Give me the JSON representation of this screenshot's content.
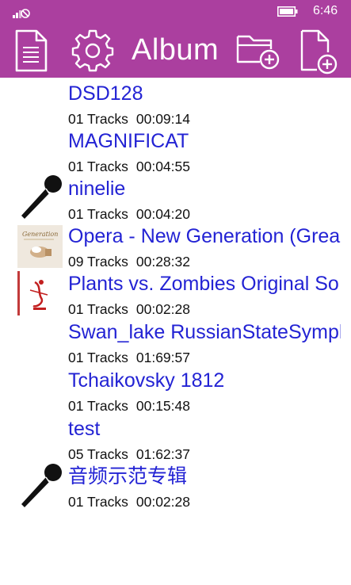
{
  "status": {
    "time": "6:46"
  },
  "header": {
    "title": "Album"
  },
  "albums": [
    {
      "name": "DSD128",
      "tracks": "01 Tracks",
      "duration": "00:09:14",
      "art": "none"
    },
    {
      "name": "MAGNIFICAT",
      "tracks": "01 Tracks",
      "duration": "00:04:55",
      "art": "none"
    },
    {
      "name": "ninelie",
      "tracks": "01 Tracks",
      "duration": "00:04:20",
      "art": "microphone-icon"
    },
    {
      "name": "Opera - New Generation (Grea",
      "tracks": "09 Tracks",
      "duration": "00:28:32",
      "art": "album-cover",
      "art_text": "Generation"
    },
    {
      "name": "Plants vs. Zombies Original So",
      "tracks": "01 Tracks",
      "duration": "00:02:28",
      "art": "album-cover"
    },
    {
      "name": "Swan_lake RussianStateSymph",
      "tracks": "01 Tracks",
      "duration": "01:69:57",
      "art": "none"
    },
    {
      "name": "Tchaikovsky 1812",
      "tracks": "01 Tracks",
      "duration": "00:15:48",
      "art": "none"
    },
    {
      "name": "test",
      "tracks": "05 Tracks",
      "duration": "01:62:37",
      "art": "none"
    },
    {
      "name": "音频示范专辑",
      "tracks": "01 Tracks",
      "duration": "00:02:28",
      "art": "microphone-icon"
    }
  ],
  "colors": {
    "accent": "#ab3f9f",
    "link": "#2323d4"
  }
}
